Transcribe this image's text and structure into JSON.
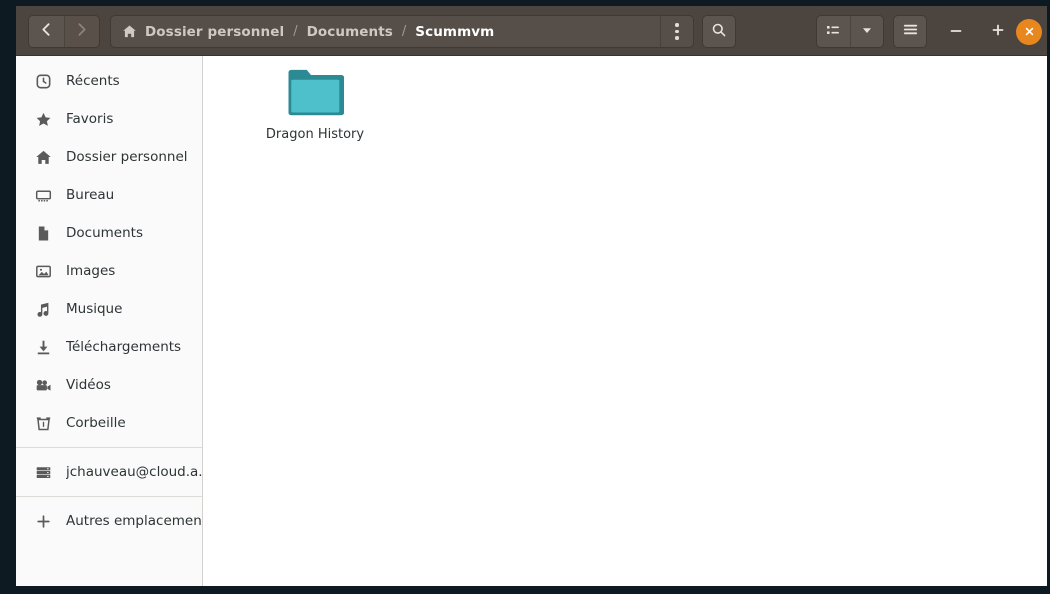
{
  "window": {
    "title": "Scummvm",
    "accent_close": "#e8871e",
    "headerbar_bg": "#4b443f",
    "sidebar_bg": "#fafafa",
    "folder_color": "#4ec0cc",
    "folder_border": "#2c8a95"
  },
  "header": {
    "back_label": "Précédent",
    "forward_label": "Suivant",
    "menu_label": "Options du dossier",
    "search_label": "Rechercher",
    "view_list_label": "Vue en liste",
    "view_dropdown_label": "Options d'affichage",
    "main_menu_label": "Menu principal",
    "minimize_label": "Réduire",
    "maximize_label": "Agrandir",
    "close_label": "Fermer",
    "breadcrumb": [
      {
        "label": "Dossier personnel",
        "icon": "home-icon",
        "current": false
      },
      {
        "label": "Documents",
        "icon": "",
        "current": false
      },
      {
        "label": "Scummvm",
        "icon": "",
        "current": true
      }
    ],
    "separator": "/"
  },
  "sidebar": {
    "items": [
      {
        "label": "Récents",
        "icon": "clock-icon"
      },
      {
        "label": "Favoris",
        "icon": "star-icon"
      },
      {
        "label": "Dossier personnel",
        "icon": "home-icon"
      },
      {
        "label": "Bureau",
        "icon": "desktop-icon"
      },
      {
        "label": "Documents",
        "icon": "document-icon"
      },
      {
        "label": "Images",
        "icon": "image-icon"
      },
      {
        "label": "Musique",
        "icon": "music-note-icon"
      },
      {
        "label": "Téléchargements",
        "icon": "download-icon"
      },
      {
        "label": "Vidéos",
        "icon": "video-camera-icon"
      },
      {
        "label": "Corbeille",
        "icon": "trash-icon"
      }
    ],
    "network": [
      {
        "label": "jchauveau@cloud.a...",
        "icon": "server-icon"
      }
    ],
    "other": [
      {
        "label": "Autres emplacements",
        "icon": "plus-icon"
      }
    ]
  },
  "main": {
    "files": [
      {
        "name": "Dragon History",
        "type": "folder"
      }
    ]
  }
}
